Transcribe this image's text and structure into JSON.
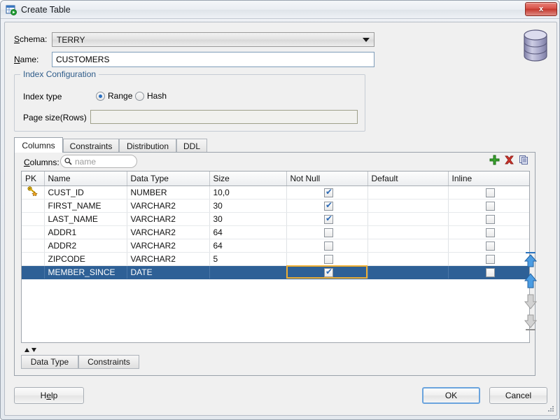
{
  "window": {
    "title": "Create Table",
    "title_icon": "table-create-icon",
    "close_label": "x",
    "db_icon": "database-icon"
  },
  "form": {
    "schema_label": "Schema:",
    "schema_mnemonic": "S",
    "schema_value": "TERRY",
    "schema_arrow_icon": "chevron-down-icon",
    "name_label": "Name:",
    "name_mnemonic": "N",
    "name_value": "CUSTOMERS",
    "name_placeholder": ""
  },
  "index_config": {
    "legend": "Index Configuration",
    "index_type_label": "Index type",
    "options": [
      {
        "label": "Range",
        "selected": true
      },
      {
        "label": "Hash",
        "selected": false
      }
    ],
    "page_size_label": "Page size(Rows)",
    "page_size_value": "",
    "page_size_enabled": false
  },
  "tabs": [
    {
      "label": "Columns",
      "active": true
    },
    {
      "label": "Constraints",
      "active": false
    },
    {
      "label": "Distribution",
      "active": false
    },
    {
      "label": "DDL",
      "active": false
    }
  ],
  "panel": {
    "columns_label": "Columns:",
    "columns_mnemonic": "C",
    "search_placeholder": "name",
    "search_value": "",
    "search_icon": "search-icon",
    "tool_icons": [
      {
        "name": "add-column-icon",
        "label": "Add"
      },
      {
        "name": "delete-column-icon",
        "label": "Delete"
      },
      {
        "name": "duplicate-column-icon",
        "label": "Duplicate"
      }
    ]
  },
  "grid": {
    "headers": [
      "PK",
      "Name",
      "Data Type",
      "Size",
      "Not Null",
      "Default",
      "Inline"
    ],
    "rows": [
      {
        "pk": true,
        "name": "CUST_ID",
        "type": "NUMBER",
        "size": "10,0",
        "not_null": true,
        "default": "",
        "inline": false,
        "selected": false
      },
      {
        "pk": false,
        "name": "FIRST_NAME",
        "type": "VARCHAR2",
        "size": "30",
        "not_null": true,
        "default": "",
        "inline": false,
        "selected": false
      },
      {
        "pk": false,
        "name": "LAST_NAME",
        "type": "VARCHAR2",
        "size": "30",
        "not_null": true,
        "default": "",
        "inline": false,
        "selected": false
      },
      {
        "pk": false,
        "name": "ADDR1",
        "type": "VARCHAR2",
        "size": "64",
        "not_null": false,
        "default": "",
        "inline": false,
        "selected": false
      },
      {
        "pk": false,
        "name": "ADDR2",
        "type": "VARCHAR2",
        "size": "64",
        "not_null": false,
        "default": "",
        "inline": false,
        "selected": false
      },
      {
        "pk": false,
        "name": "ZIPCODE",
        "type": "VARCHAR2",
        "size": "5",
        "not_null": false,
        "default": "",
        "inline": false,
        "selected": false
      },
      {
        "pk": false,
        "name": "MEMBER_SINCE",
        "type": "DATE",
        "size": "",
        "not_null": true,
        "default": "",
        "inline": false,
        "selected": true
      }
    ]
  },
  "reorder_buttons": [
    {
      "name": "move-to-top-icon",
      "enabled": true
    },
    {
      "name": "move-up-icon",
      "enabled": true
    },
    {
      "name": "move-down-icon",
      "enabled": false
    },
    {
      "name": "move-to-bottom-icon",
      "enabled": false
    }
  ],
  "lower_tabs": [
    {
      "label": "Data Type",
      "active": true
    },
    {
      "label": "Constraints",
      "active": false
    }
  ],
  "footer": {
    "help_label": "Help",
    "help_mnemonic": "e",
    "ok_label": "OK",
    "cancel_label": "Cancel"
  },
  "colors": {
    "selection": "#2e6096",
    "focus_border": "#edae33",
    "legend_text": "#2e5c8a",
    "default_button_border": "#6ba4dd",
    "close_button": "#c5372d"
  }
}
